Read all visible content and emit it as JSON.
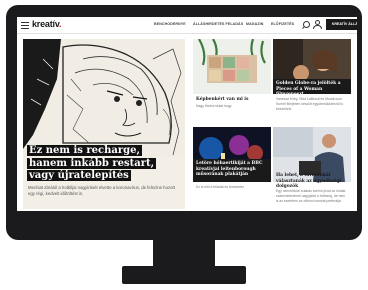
{
  "brand": {
    "logo_text": "kreatív",
    "logo_dot": "."
  },
  "nav": {
    "items": [
      {
        "label": "BENCHODERNYE"
      },
      {
        "label": "ÁLLÁSHIRDETÉS FELADÁS"
      },
      {
        "label": "MAGAZIN"
      },
      {
        "label": "ELŐFIZETÉS"
      }
    ],
    "cta_label": "KREATÍV ÁLLÁS"
  },
  "hero": {
    "title": "Ez nem is recharge, hanem inkább restart, vagy újratelepítés",
    "excerpt": "Mechiat Zinától a hotbiljai nagyírásét elvette a koronavírus, de felszíne hozott egy régi, kedvelt időtöltést is."
  },
  "cards": [
    {
      "title": "Képbenkért van mi is",
      "desc": "Nagy lövést mutat hogy"
    },
    {
      "title": "Golden Globe-ra jelölték a Pieces of a Woman filmzeneszt",
      "desc": "Vanessa Kirby, Shia LaBeouf és Mundruczó Kornél filmjében készült együttműködésről is beszélünk"
    },
    {
      "title": "Letöre hóhaertikiját a BBC kreatívjai leitenborough műsorának plakátján",
      "desc": "Ez is elől a feladat és tervezeter"
    },
    {
      "title": "Ha lehet, a távmunkát választanák az ügynökségi dolgozók",
      "desc": "Egy nemzetközi kutatás szerint jóval az irodák szakembereinek nagyjából a többség, de nem is az esetében az otthoni munkát preferálja."
    }
  ],
  "colors": {
    "accent": "#e30613",
    "dark": "#1a1a1a",
    "bezel": "#1b1b1d"
  }
}
